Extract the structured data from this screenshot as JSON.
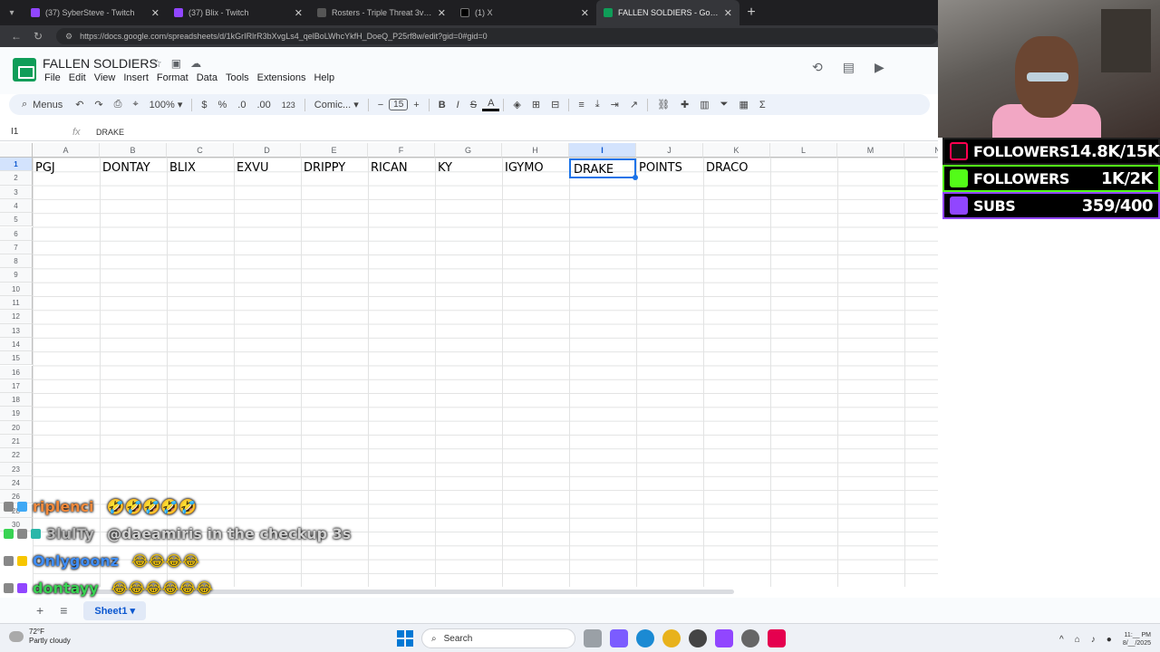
{
  "browser": {
    "tabs": [
      {
        "title": "(37) SyberSteve - Twitch",
        "active": false
      },
      {
        "title": "(37) Blix - Twitch",
        "active": false
      },
      {
        "title": "Rosters - Triple Threat 3v3 | Check",
        "active": false
      },
      {
        "title": "(1) X",
        "active": false
      },
      {
        "title": "FALLEN SOLDIERS - Google Sheets",
        "active": true
      }
    ],
    "url": "https://docs.google.com/spreadsheets/d/1kGrIRlrR3bXvgLs4_qelBoLWhcYkfH_DoeQ_P25rf8w/edit?gid=0#gid=0"
  },
  "sheets": {
    "doc_title": "FALLEN SOLDIERS",
    "menu": [
      "File",
      "Edit",
      "View",
      "Insert",
      "Format",
      "Data",
      "Tools",
      "Extensions",
      "Help"
    ],
    "toolbar": {
      "menus_label": "Menus",
      "zoom": "100%",
      "currency": "$",
      "percent": "%",
      "dec_decrease": ".0",
      "dec_increase": ".00",
      "number_format": "123",
      "font": "Comic...",
      "font_size": "15",
      "bold": "B",
      "italic": "I",
      "strike": "S",
      "text_color": "A"
    },
    "name_box": "I1",
    "formula": "DRAKE",
    "columns": [
      "A",
      "B",
      "C",
      "D",
      "E",
      "F",
      "G",
      "H",
      "I",
      "J",
      "K",
      "L",
      "M",
      "N"
    ],
    "selected_column": "I",
    "row_numbers": [
      "1",
      "2",
      "3",
      "4",
      "5",
      "6",
      "7",
      "8",
      "9",
      "10",
      "11",
      "12",
      "13",
      "14",
      "15",
      "16",
      "17",
      "18",
      "19",
      "20",
      "21",
      "22",
      "23",
      "24",
      "26",
      "28",
      "30"
    ],
    "row1": [
      "PGJ",
      "DONTAY",
      "BLIX",
      "EXVU",
      "DRIPPY",
      "RICAN",
      "KY",
      "IGYMO",
      "DRAKE",
      "POINTS",
      "DRACO"
    ],
    "active_cell_index": 8,
    "sheet_tab": "Sheet1"
  },
  "overlay": {
    "stats": [
      {
        "platform": "tiktok",
        "label": "FOLLOWERS",
        "value": "14.8K/15K",
        "color": "#ff0050"
      },
      {
        "platform": "kick",
        "label": "FOLLOWERS",
        "value": "1K/2K",
        "color": "#53fc18"
      },
      {
        "platform": "twitch",
        "label": "SUBS",
        "value": "359/400",
        "color": "#9146ff"
      }
    ],
    "chat": [
      {
        "user": "riplenci",
        "color": "#f28a3c",
        "message": "🤣🤣🤣🤣🤣"
      },
      {
        "user": "3lulTy",
        "color": "#b5b5b5",
        "message": "@daeamiris in the checkup 3s"
      },
      {
        "user": "Onlygoonz",
        "color": "#3f8df5",
        "message": "😂😂😂😂"
      },
      {
        "user": "dontayy",
        "color": "#39d353",
        "message": "😂😂😂😂😂😂"
      }
    ]
  },
  "taskbar": {
    "temperature": "72°F",
    "weather": "Partly cloudy",
    "search_label": "Search",
    "time": "11:__ PM",
    "date": "8/__/2025"
  }
}
